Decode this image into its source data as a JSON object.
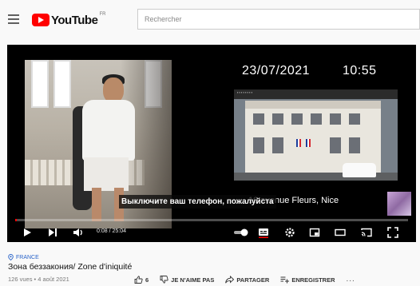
{
  "header": {
    "logo_text": "YouTube",
    "logo_region": "FR",
    "search_placeholder": "Rechercher"
  },
  "player": {
    "overlay_date": "23/07/2021",
    "overlay_time": "10:55",
    "overlay_location": "10 avenue Fleurs, Nice",
    "subtitle": "Выключите ваш телефон, пожалуйста",
    "time_display": "0:08 / 25:04",
    "progress_fraction": 0.005,
    "accent_color": "#ff0000"
  },
  "video": {
    "channel": "FRANCE",
    "title": "Зона беззакония/ Zone d'iniquité",
    "meta": "126 vues • 4 août 2021"
  },
  "actions": {
    "like_count": "6",
    "dislike_label": "JE N'AIME PAS",
    "share_label": "PARTAGER",
    "save_label": "ENREGISTRER",
    "more_label": "..."
  }
}
